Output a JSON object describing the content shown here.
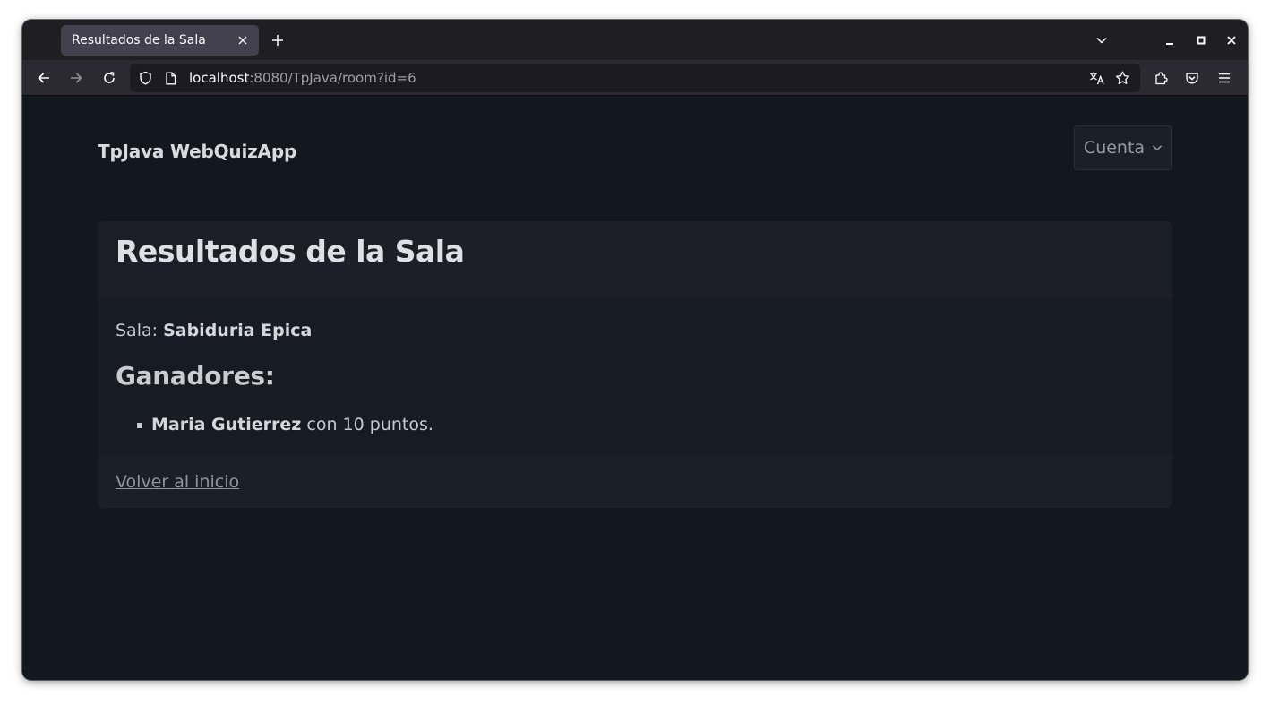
{
  "browser": {
    "tab_title": "Resultados de la Sala",
    "url_host": "localhost",
    "url_rest": ":8080/TpJava/room?id=6"
  },
  "navbar": {
    "brand": "TpJava WebQuizApp",
    "account_label": "Cuenta"
  },
  "card": {
    "title": "Resultados de la Sala",
    "sala_label": "Sala: ",
    "sala_name": "Sabiduria Epica",
    "winners_heading": "Ganadores:",
    "winners": [
      {
        "name": "Maria Gutierrez",
        "suffix": " con 10 puntos."
      }
    ],
    "back_link": "Volver al inicio"
  },
  "colors": {
    "page_bg": "#13171f",
    "card_header_bg": "#1c1f27",
    "link": "#8f949d"
  }
}
